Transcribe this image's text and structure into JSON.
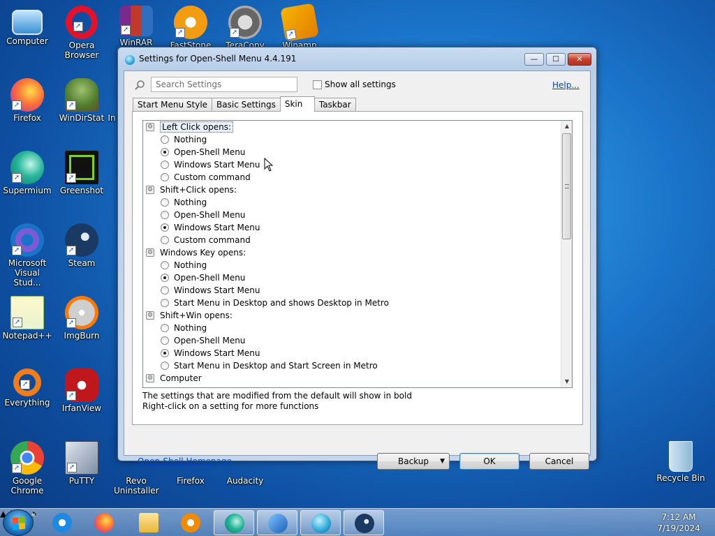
{
  "desktop": {
    "icons": [
      {
        "label": "Computer"
      },
      {
        "label": "Opera Browser"
      },
      {
        "label": "WinRAR"
      },
      {
        "label": "FastStone"
      },
      {
        "label": "TeraCopy"
      },
      {
        "label": "Winamp"
      },
      {
        "label": "Firefox"
      },
      {
        "label": "WinDirStat"
      },
      {
        "label": "Supermium"
      },
      {
        "label": "Greenshot"
      },
      {
        "label": "Microsoft Visual Stud..."
      },
      {
        "label": "Steam"
      },
      {
        "label": "Notepad++"
      },
      {
        "label": "ImgBurn"
      },
      {
        "label": "Everything"
      },
      {
        "label": "IrfanView"
      },
      {
        "label": "Google Chrome"
      },
      {
        "label": "PuTTY"
      },
      {
        "label": "Revo Uninstaller"
      },
      {
        "label": "Firefox"
      },
      {
        "label": "Audacity"
      },
      {
        "label": "Recycle Bin"
      }
    ],
    "partial_label": "In"
  },
  "window": {
    "title": "Settings for Open-Shell Menu 4.4.191",
    "buttons": {
      "minimize": "—",
      "maximize": "☐",
      "close": "✕"
    },
    "search": {
      "placeholder": "Search Settings",
      "value": ""
    },
    "show_all_label": "Show all settings",
    "help_label": "Help...",
    "tabs": [
      {
        "label": "Start Menu Style",
        "active": false
      },
      {
        "label": "Basic Settings",
        "active": false
      },
      {
        "label": "Skin",
        "active": true
      },
      {
        "label": "Taskbar",
        "active": false
      }
    ],
    "settings": [
      {
        "kind": "group",
        "label": "Left Click opens:",
        "focused": true
      },
      {
        "kind": "option",
        "label": "Nothing",
        "selected": false
      },
      {
        "kind": "option",
        "label": "Open-Shell Menu",
        "selected": true
      },
      {
        "kind": "option",
        "label": "Windows Start Menu",
        "selected": false
      },
      {
        "kind": "option",
        "label": "Custom command",
        "selected": false
      },
      {
        "kind": "group",
        "label": "Shift+Click opens:"
      },
      {
        "kind": "option",
        "label": "Nothing",
        "selected": false
      },
      {
        "kind": "option",
        "label": "Open-Shell Menu",
        "selected": false
      },
      {
        "kind": "option",
        "label": "Windows Start Menu",
        "selected": true
      },
      {
        "kind": "option",
        "label": "Custom command",
        "selected": false
      },
      {
        "kind": "group",
        "label": "Windows Key opens:"
      },
      {
        "kind": "option",
        "label": "Nothing",
        "selected": false
      },
      {
        "kind": "option",
        "label": "Open-Shell Menu",
        "selected": true
      },
      {
        "kind": "option",
        "label": "Windows Start Menu",
        "selected": false
      },
      {
        "kind": "option",
        "label": "Start Menu in Desktop and shows Desktop in Metro",
        "selected": false
      },
      {
        "kind": "group",
        "label": "Shift+Win opens:"
      },
      {
        "kind": "option",
        "label": "Nothing",
        "selected": false
      },
      {
        "kind": "option",
        "label": "Open-Shell Menu",
        "selected": false
      },
      {
        "kind": "option",
        "label": "Windows Start Menu",
        "selected": true
      },
      {
        "kind": "option",
        "label": "Start Menu in Desktop and Start Screen in Metro",
        "selected": false
      },
      {
        "kind": "group",
        "label": "Computer"
      }
    ],
    "hint_line1": "The settings that are modified from the default will show in bold",
    "hint_line2": "Right-click on a setting for more functions",
    "homepage_label": "Open-Shell Homepage",
    "backup_label": "Backup",
    "ok_label": "OK",
    "cancel_label": "Cancel"
  },
  "taskbar": {
    "items": [
      {
        "icon": "internet-explorer-icon",
        "running": false
      },
      {
        "icon": "firefox-icon",
        "running": false
      },
      {
        "icon": "file-explorer-icon",
        "running": false
      },
      {
        "icon": "media-player-icon",
        "running": false
      },
      {
        "icon": "supermium-icon",
        "running": true
      },
      {
        "icon": "open-shell-icon",
        "running": true
      },
      {
        "icon": "shell-settings-icon",
        "running": true
      },
      {
        "icon": "steam-icon",
        "running": true
      }
    ],
    "clock_time": "7:12 AM",
    "clock_date": "7/19/2024"
  }
}
